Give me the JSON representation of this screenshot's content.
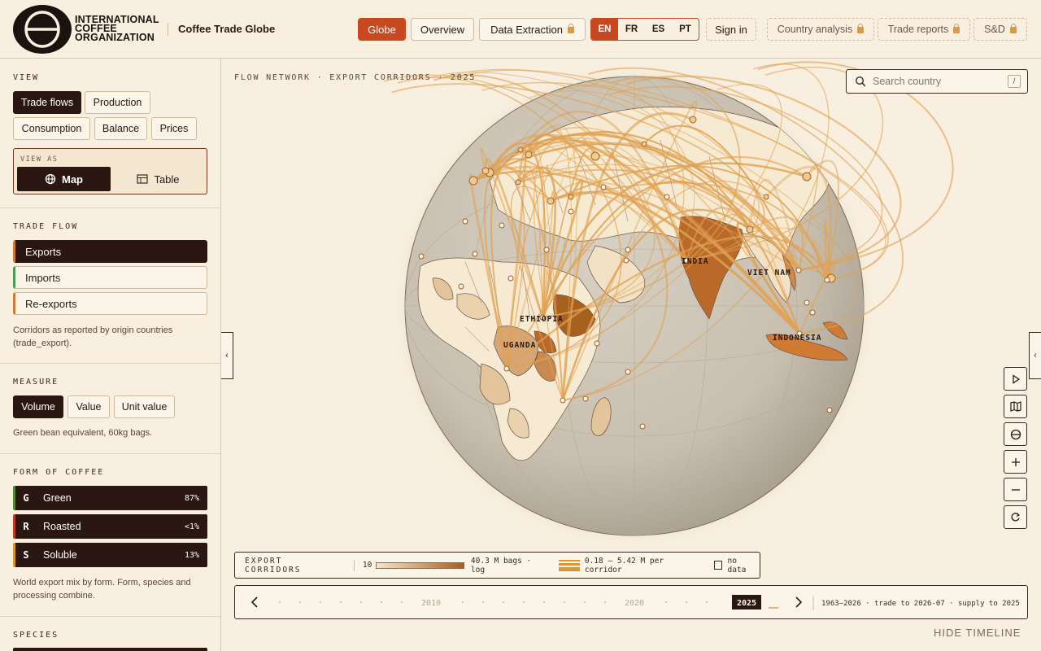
{
  "header": {
    "org_lines": [
      "INTERNATIONAL",
      "COFFEE",
      "ORGANIZATION"
    ],
    "app_title": "Coffee Trade Globe",
    "nav": [
      {
        "label": "Globe",
        "active": true
      },
      {
        "label": "Overview"
      },
      {
        "label": "Data Extraction",
        "locked": true
      }
    ],
    "languages": [
      "EN",
      "FR",
      "ES",
      "PT"
    ],
    "active_language": "EN",
    "sign_in": "Sign in",
    "locked_links": [
      "Country analysis",
      "Trade reports",
      "S&D"
    ]
  },
  "sidebar": {
    "view": {
      "title": "VIEW",
      "options": [
        "Trade flows",
        "Production",
        "Consumption",
        "Balance",
        "Prices"
      ],
      "selected": "Trade flows",
      "view_as_label": "VIEW AS",
      "view_as": [
        "Map",
        "Table"
      ],
      "view_as_selected": "Map"
    },
    "trade_flow": {
      "title": "TRADE FLOW",
      "options": [
        "Exports",
        "Imports",
        "Re-exports"
      ],
      "selected": "Exports",
      "note": "Corridors as reported by origin countries (trade_export)."
    },
    "measure": {
      "title": "MEASURE",
      "options": [
        "Volume",
        "Value",
        "Unit value"
      ],
      "selected": "Volume",
      "note": "Green bean equivalent, 60kg bags."
    },
    "form": {
      "title": "FORM OF COFFEE",
      "items": [
        {
          "code": "G",
          "name": "Green",
          "pct": "87%",
          "color": "#4c8a3a"
        },
        {
          "code": "R",
          "name": "Roasted",
          "pct": "<1%",
          "color": "#c33a22"
        },
        {
          "code": "S",
          "name": "Soluble",
          "pct": "13%",
          "color": "#d9952f"
        }
      ],
      "note": "World export mix by form. Form, species and processing combine."
    },
    "species": {
      "title": "SPECIES"
    }
  },
  "map": {
    "caption": "FLOW NETWORK · EXPORT CORRIDORS · 2025",
    "search_placeholder": "Search country",
    "search_shortcut": "/",
    "country_labels": [
      "INDIA",
      "VIET NAM",
      "ETHIOPIA",
      "UGANDA",
      "INDONESIA"
    ]
  },
  "legend": {
    "title": "EXPORT CORRIDORS",
    "scale_min": "10",
    "scale_max": "40.3 M bags · log",
    "corridor_range": "0.18 – 5.42 M per corridor",
    "no_data": "no data"
  },
  "timeline": {
    "marks": [
      "2010",
      "2020"
    ],
    "current_year": "2025",
    "coverage": "1963–2026 · trade to 2026-07 · supply to 2025",
    "hide_label": "HIDE TIMELINE"
  }
}
